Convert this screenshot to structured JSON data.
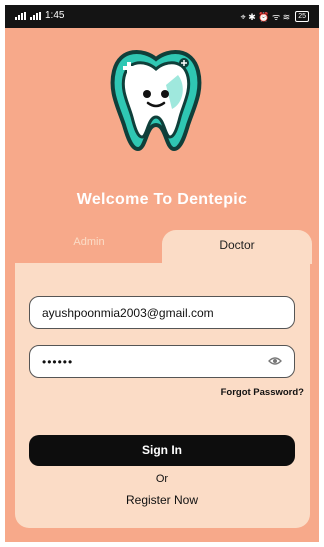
{
  "statusbar": {
    "carrier": "..ıl ..ıl",
    "time": "1:45",
    "icons": "⌖ ✱ ⏰ ᯤ ≋",
    "battery": "25"
  },
  "header": {
    "welcome": "Welcome To Dentepic"
  },
  "tabs": {
    "admin": "Admin",
    "doctor": "Doctor"
  },
  "form": {
    "email_value": "ayushpoonmia2003@gmail.com",
    "password_value": "••••••",
    "forgot_label": "Forgot Password?",
    "signin_label": "Sign In",
    "or_label": "Or",
    "register_label": "Register Now"
  },
  "colors": {
    "background": "#F7A98A",
    "card": "#FBDCC6",
    "tooth_outline": "#2FC7B3",
    "button": "#0d0d0d"
  }
}
